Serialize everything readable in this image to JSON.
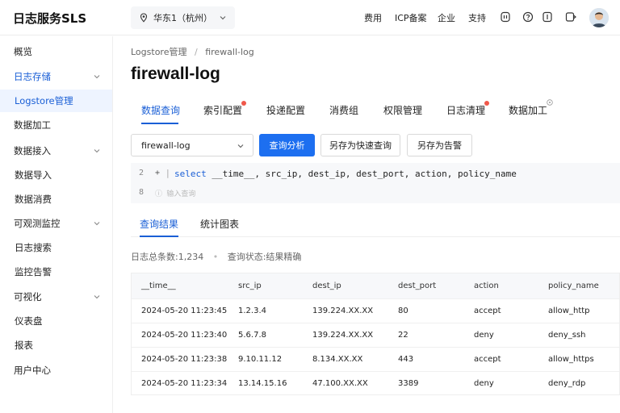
{
  "header": {
    "logo": "日志服务SLS",
    "region": "华东1（杭州）",
    "nav": [
      "费用",
      "ICP备案",
      "企业",
      "支持"
    ]
  },
  "sidebar": {
    "items": [
      {
        "label": "概览",
        "level": 0,
        "chevron": false,
        "state": "normal"
      },
      {
        "label": "日志存储",
        "level": 0,
        "chevron": true,
        "state": "open"
      },
      {
        "label": "Logstore管理",
        "level": 1,
        "chevron": false,
        "state": "active"
      },
      {
        "label": "数据加工",
        "level": 0,
        "chevron": false,
        "state": "normal"
      },
      {
        "label": "数据接入",
        "level": 0,
        "chevron": true,
        "state": "normal"
      },
      {
        "label": "数据导入",
        "level": 1,
        "chevron": false,
        "state": "normal"
      },
      {
        "label": "数据消费",
        "level": 1,
        "chevron": false,
        "state": "normal"
      },
      {
        "label": "可观测监控",
        "level": 0,
        "chevron": true,
        "state": "normal"
      },
      {
        "label": "日志搜索",
        "level": 1,
        "chevron": false,
        "state": "normal"
      },
      {
        "label": "监控告警",
        "level": 1,
        "chevron": false,
        "state": "normal"
      },
      {
        "label": "可视化",
        "level": 0,
        "chevron": true,
        "state": "normal"
      },
      {
        "label": "仪表盘",
        "level": 1,
        "chevron": false,
        "state": "normal"
      },
      {
        "label": "报表",
        "level": 1,
        "chevron": false,
        "state": "normal"
      },
      {
        "label": "用户中心",
        "level": 0,
        "chevron": false,
        "state": "normal"
      }
    ]
  },
  "breadcrumb": {
    "parent": "Logstore管理",
    "sep": "/",
    "current": "firewall-log"
  },
  "page_title": "firewall-log",
  "tabs": [
    {
      "label": "数据查询",
      "active": true,
      "dot": false
    },
    {
      "label": "索引配置",
      "active": false,
      "dot": true
    },
    {
      "label": "投递配置",
      "active": false,
      "dot": false
    },
    {
      "label": "消费组",
      "active": false,
      "dot": false
    },
    {
      "label": "权限管理",
      "active": false,
      "dot": false
    },
    {
      "label": "日志清理",
      "active": false,
      "dot": true
    },
    {
      "label": "数据加工",
      "active": false,
      "dot": false
    }
  ],
  "toolbar": {
    "logstore_select": "firewall-log",
    "query_button": "查询分析",
    "save_quick_button": "另存为快速查询",
    "save_alert_button": "另存为告警"
  },
  "editor": {
    "line1_number": "2",
    "line1_marker": "+",
    "query_keyword": "select",
    "query_rest": " __time__, src_ip, dest_ip, dest_port, action, policy_name",
    "line2_number": "8",
    "placeholder": "ⓘ 输入查询"
  },
  "result_tabs": [
    "查询结果",
    "统计图表"
  ],
  "stats": {
    "total": "日志总条数:1,234",
    "status": "查询状态:结果精确"
  },
  "table": {
    "columns": [
      "__time__",
      "src_ip",
      "dest_ip",
      "dest_port",
      "action",
      "policy_name"
    ],
    "rows": [
      [
        "2024-05-20 11:23:45",
        "1.2.3.4",
        "139.224.XX.XX",
        "80",
        "accept",
        "allow_http"
      ],
      [
        "2024-05-20 11:23:40",
        "5.6.7.8",
        "139.224.XX.XX",
        "22",
        "deny",
        "deny_ssh"
      ],
      [
        "2024-05-20 11:23:38",
        "9.10.11.12",
        "8.134.XX.XX",
        "443",
        "accept",
        "allow_https"
      ],
      [
        "2024-05-20 11:23:34",
        "13.14.15.16",
        "47.100.XX.XX",
        "3389",
        "deny",
        "deny_rdp"
      ]
    ]
  },
  "colors": {
    "accent": "#1d6ff0",
    "active_text": "#1a5fd6",
    "active_bg": "#eef4ff",
    "badge": "#f0584a"
  }
}
